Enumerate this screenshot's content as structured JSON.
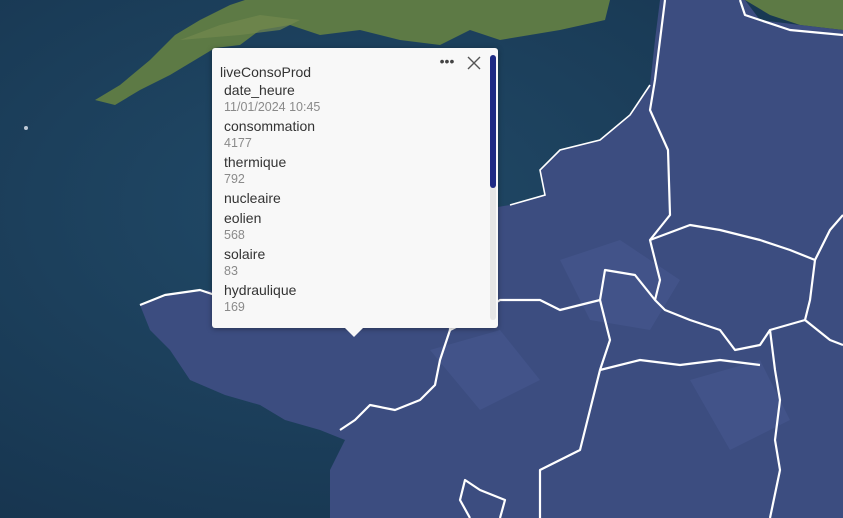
{
  "popup": {
    "title": "liveConsoProd",
    "more_icon": "•••",
    "fields": [
      {
        "name": "date_heure",
        "value": "11/01/2024 10:45"
      },
      {
        "name": "consommation",
        "value": "4177"
      },
      {
        "name": "thermique",
        "value": "792"
      },
      {
        "name": "nucleaire",
        "value": ""
      },
      {
        "name": "eolien",
        "value": "568"
      },
      {
        "name": "solaire",
        "value": "83"
      },
      {
        "name": "hydraulique",
        "value": "169"
      }
    ],
    "scroll_fraction": 0.5
  },
  "colors": {
    "sea": "#1b3f5c",
    "land_green": "#5d7a45",
    "land_blue": "#3c4d80",
    "border": "#ffffff",
    "scroll_thumb": "#1e2a84"
  }
}
